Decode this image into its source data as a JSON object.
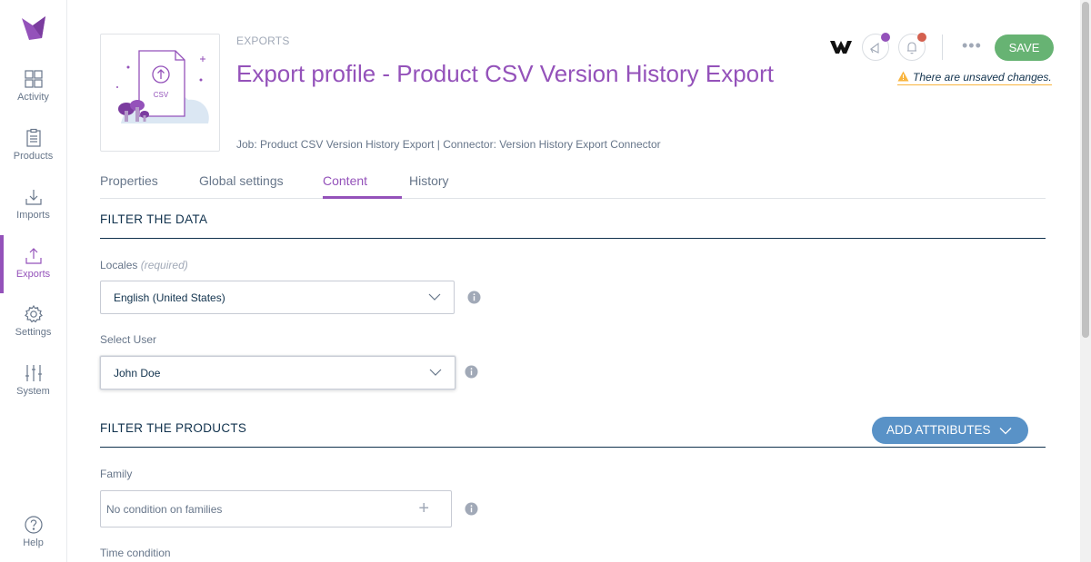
{
  "sidebar": {
    "items": [
      {
        "label": "Activity",
        "icon": "dashboard-grid-icon"
      },
      {
        "label": "Products",
        "icon": "clipboard-icon"
      },
      {
        "label": "Imports",
        "icon": "import-tray-icon"
      },
      {
        "label": "Exports",
        "icon": "export-tray-icon",
        "active": true
      },
      {
        "label": "Settings",
        "icon": "gear-icon"
      },
      {
        "label": "System",
        "icon": "sliders-icon"
      }
    ],
    "help": "Help"
  },
  "header": {
    "breadcrumb": "EXPORTS",
    "title": "Export profile - Product CSV Version History Export",
    "subtitle": "Job: Product CSV Version History Export | Connector: Version History Export Connector",
    "illustration_badge": "CSV",
    "more": "•••",
    "save_label": "SAVE",
    "unsaved_text": "There are unsaved changes."
  },
  "tabs": [
    "Properties",
    "Global settings",
    "Content",
    "History"
  ],
  "active_tab": "Content",
  "filter_data": {
    "title": "FILTER THE DATA",
    "locales_label": "Locales",
    "locales_required": "(required)",
    "locales_value": "English (United States)",
    "user_label": "Select User",
    "user_value": "John Doe"
  },
  "filter_products": {
    "title": "FILTER THE PRODUCTS",
    "add_attributes": "ADD ATTRIBUTES",
    "family_label": "Family",
    "family_value": "No condition on families",
    "time_label": "Time condition"
  },
  "colors": {
    "brand": "#9452ba",
    "save": "#67b373",
    "add_attributes": "#5992c7",
    "warning": "#f9b53f",
    "text_dark": "#11324d"
  }
}
